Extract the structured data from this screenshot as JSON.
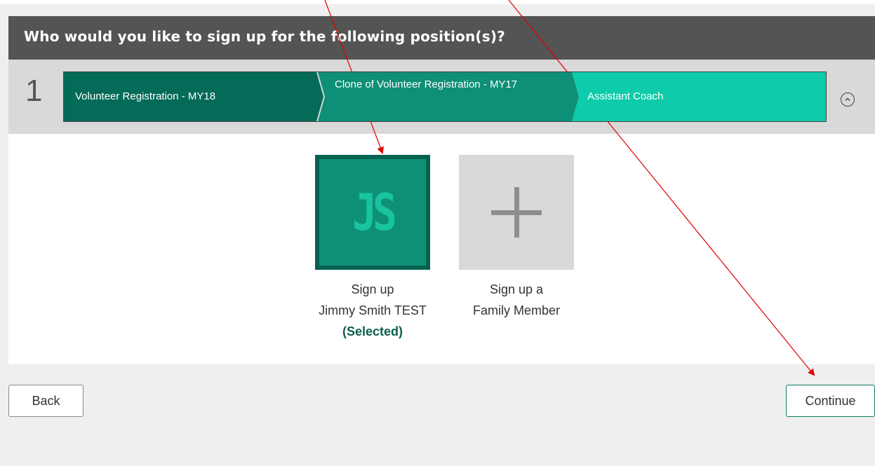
{
  "header": {
    "title": "Who would you like to sign up for the following position(s)?"
  },
  "position_row": {
    "number": "1",
    "breadcrumb": [
      "Volunteer Registration - MY18",
      "Clone of Volunteer Registration - MY17",
      "Assistant Coach"
    ],
    "collapse_icon": "chevron-up-circle-icon"
  },
  "tiles": [
    {
      "initials": "JS",
      "line1": "Sign up",
      "line2": "Jimmy Smith TEST",
      "status": "(Selected)"
    },
    {
      "icon": "plus-icon",
      "line1": "Sign up a",
      "line2": "Family Member"
    }
  ],
  "buttons": {
    "back": "Back",
    "continue": "Continue"
  },
  "colors": {
    "header_bg": "#545454",
    "crumb_dark": "#046b58",
    "crumb_mid": "#0e8f77",
    "crumb_light": "#0ecbab",
    "selected_tile": "#0e9076",
    "annotation_arrow": "#e00000"
  }
}
